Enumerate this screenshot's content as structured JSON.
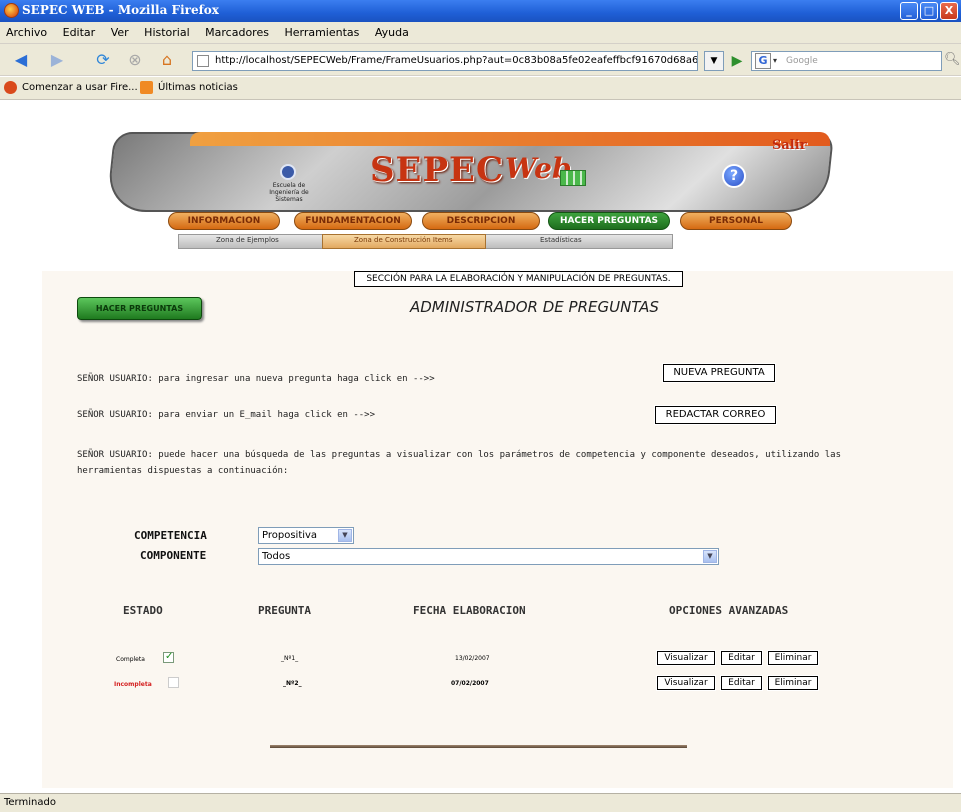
{
  "window": {
    "title": "SEPEC WEB - Mozilla Firefox",
    "minimize": "_",
    "maximize": "□",
    "close": "X"
  },
  "menu": [
    "Archivo",
    "Editar",
    "Ver",
    "Historial",
    "Marcadores",
    "Herramientas",
    "Ayuda"
  ],
  "nav": {
    "url": "http://localhost/SEPECWeb/Frame/FrameUsuarios.php?aut=0c83b08a5fe02eafeffbcf91670d68a6",
    "search_placeholder": "Google",
    "search_engine_icon": "G"
  },
  "bookmarks": [
    "Comenzar a usar Fire...",
    "Últimas noticias"
  ],
  "banner": {
    "logo_text": "Escuela de Ingeniería de Sistemas",
    "title": "SEPEC",
    "title_web": "Web",
    "salir": "Salir",
    "help": "?",
    "tabs": [
      "INFORMACION",
      "FUNDAMENTACION",
      "DESCRIPCION",
      "HACER PREGUNTAS",
      "PERSONAL"
    ],
    "active_tab": "HACER PREGUNTAS",
    "subtabs": [
      "Zona de Ejemplos",
      "Zona de Construcción Items",
      "Estadísticas"
    ]
  },
  "tooltip": "SECCIÓN PARA LA ELABORACIÓN Y MANIPULACIÓN DE PREGUNTAS.",
  "main": {
    "section_button": "HACER PREGUNTAS",
    "title": "ADMINISTRADOR DE PREGUNTAS",
    "msg_new": "SEÑOR USUARIO: para ingresar una nueva pregunta haga click en -->>",
    "btn_new": "NUEVA PREGUNTA",
    "msg_mail": "SEÑOR USUARIO: para enviar un E_mail  haga click en -->>",
    "btn_mail": "REDACTAR CORREO",
    "msg_search_1": "SEÑOR USUARIO: puede hacer una búsqueda de las preguntas a visualizar con los parámetros de competencia y componente deseados, utilizando las",
    "msg_search_2": "herramientas dispuestas a continuación:",
    "competencia_label": "COMPETENCIA",
    "competencia_value": "Propositiva",
    "componente_label": "COMPONENTE",
    "componente_value": "Todos"
  },
  "table": {
    "headers": [
      "ESTADO",
      "PREGUNTA",
      "FECHA ELABORACION",
      "OPCIONES AVANZADAS"
    ],
    "rows": [
      {
        "estado": "Completa",
        "checked": true,
        "pregunta": "_Nº1_",
        "fecha": "13/02/2007"
      },
      {
        "estado": "Incompleta",
        "checked": false,
        "pregunta": "_Nº2_",
        "fecha": "07/02/2007"
      }
    ],
    "actions": [
      "Visualizar",
      "Editar",
      "Eliminar"
    ]
  },
  "status": "Terminado",
  "colors": {
    "accent": "#c73412",
    "active_tab": "#2a8a2a",
    "incomplete": "#d42020"
  }
}
